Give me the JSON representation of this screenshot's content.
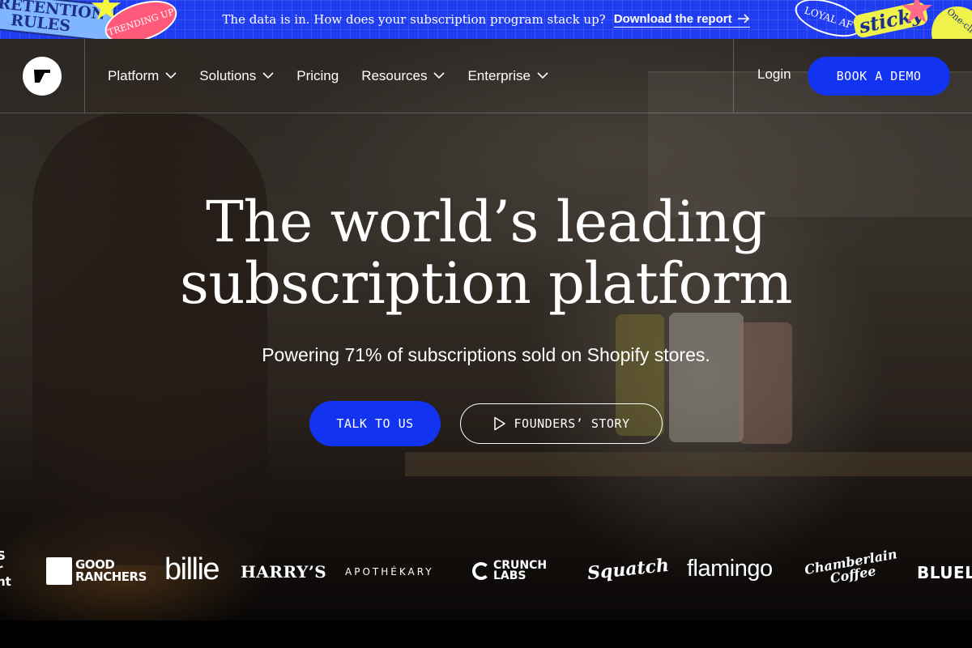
{
  "banner": {
    "text": "The data is in. How does your subscription program stack up?",
    "link_label": "Download the report",
    "stickers": {
      "retention_line1": "RETENTION",
      "retention_line2": "RULES",
      "trending": "TRENDING UP",
      "loyal": "LOYAL AF",
      "sticky": "sticky",
      "one_click": "One-click"
    }
  },
  "nav": {
    "items": [
      {
        "label": "Platform",
        "has_dropdown": true
      },
      {
        "label": "Solutions",
        "has_dropdown": true
      },
      {
        "label": "Pricing",
        "has_dropdown": false
      },
      {
        "label": "Resources",
        "has_dropdown": true
      },
      {
        "label": "Enterprise",
        "has_dropdown": true
      }
    ],
    "login_label": "Login",
    "demo_label": "BOOK A DEMO"
  },
  "hero": {
    "headline_line1": "The world’s leading",
    "headline_line2": "subscription platform",
    "subhead": "Powering 71% of subscriptions sold on Shopify stores.",
    "cta_primary": "TALK TO US",
    "cta_secondary": "FOUNDERS’ STORY"
  },
  "logos": {
    "cut_off_left_line1": "S",
    "cut_off_left_line2": "r",
    "cut_off_left_line3": "nt",
    "good_ranchers_line1": "GOOD",
    "good_ranchers_line2": "RANCHERS",
    "billie": "billie",
    "harrys": "HARRY’S",
    "apothekary": "APOTHÉKARY",
    "crunch_labs_line1": "CRUNCH",
    "crunch_labs_line2": "LABS",
    "squatch": "Squatch",
    "flamingo": "flamingo",
    "chamberlain_line1": "Chamberlain",
    "chamberlain_line2": "Coffee",
    "bluelan": "BLUELA"
  },
  "colors": {
    "brand_blue": "#1234f0",
    "banner_blue": "#1f3cf0",
    "sticker_yellow": "#eef24a",
    "sticker_pink": "#ff5a7a"
  },
  "icons": {
    "logo": "recharge-logo-icon",
    "dropdown": "chevron-down-icon",
    "banner_arrow": "arrow-right-icon",
    "play": "play-icon"
  }
}
